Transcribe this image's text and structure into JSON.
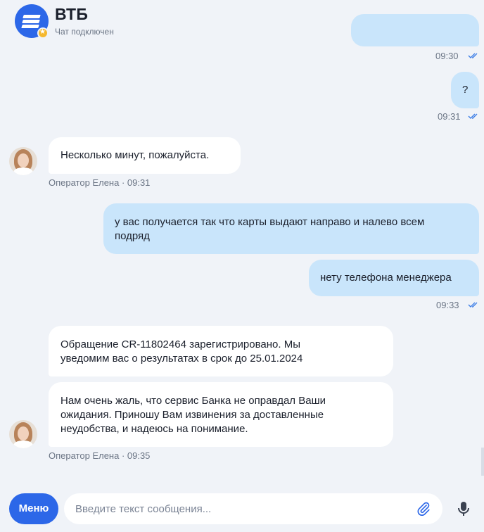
{
  "header": {
    "title": "ВТБ",
    "status": "Чат подключен"
  },
  "messages": [
    {
      "id": "m0",
      "direction": "out",
      "text": "",
      "time": "09:30",
      "read": true
    },
    {
      "id": "m1",
      "direction": "out",
      "text": "?",
      "time": "09:31",
      "read": true
    },
    {
      "id": "m2",
      "direction": "in",
      "text": "Несколько минут, пожалуйста.",
      "sender": "Оператор Елена · 09:31"
    },
    {
      "id": "m3",
      "direction": "out",
      "text_lines": [
        "у вас получается так что карты выдают направо и налево всем",
        "подряд"
      ]
    },
    {
      "id": "m4",
      "direction": "out",
      "text": "нету телефона менеджера",
      "time": "09:33",
      "read": true
    },
    {
      "id": "m5",
      "direction": "in",
      "text_lines": [
        "Обращение CR-11802464 зарегистрировано. Мы",
        "уведомим вас о результатах в срок до 25.01.2024"
      ]
    },
    {
      "id": "m6",
      "direction": "in",
      "text_lines": [
        "Нам очень жаль, что сервис Банка не оправдал Ваши",
        "ожидания. Приношу Вам извинения за доставленные",
        "неудобства, и надеюсь на понимание."
      ],
      "sender": "Оператор Елена · 09:35"
    }
  ],
  "composer": {
    "menu_label": "Меню",
    "placeholder": "Введите текст сообщения..."
  },
  "colors": {
    "brand": "#2c67e8",
    "outgoing_bubble": "#c9e5fb",
    "incoming_bubble": "#ffffff",
    "background": "#f0f3f8",
    "read_check": "#3f7fe6"
  },
  "icons": {
    "logo": "vtb-logo-icon",
    "badge": "star-badge-icon",
    "collapse": "collapse-arrows-icon",
    "read": "double-check-icon",
    "attach": "paperclip-icon",
    "mic": "microphone-icon"
  }
}
